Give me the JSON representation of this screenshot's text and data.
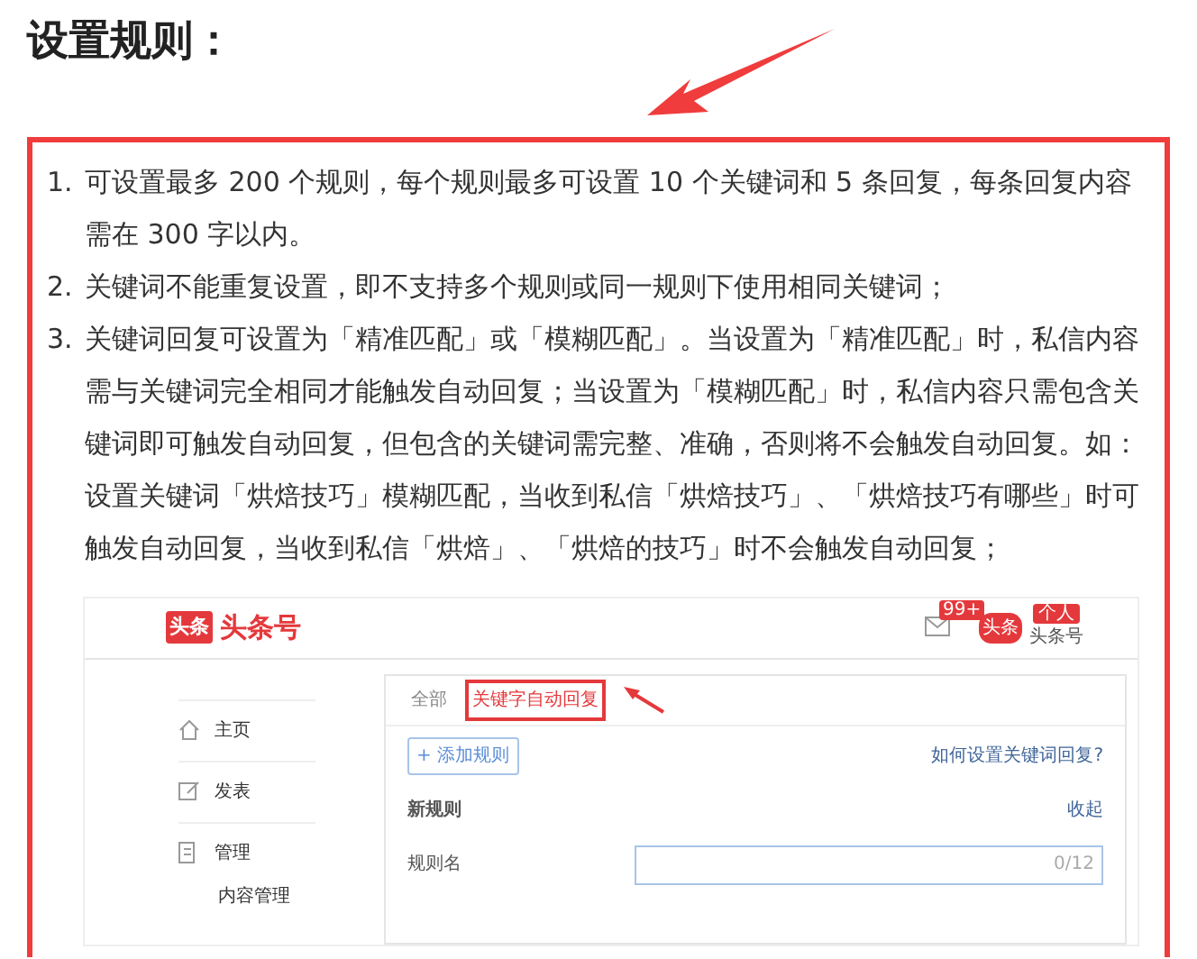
{
  "heading": "设置规则：",
  "rules": [
    {
      "number": "1.",
      "text": "可设置最多 200 个规则，每个规则最多可设置 10 个关键词和 5 条回复，每条回复内容需在 300 字以内。"
    },
    {
      "number": "2.",
      "text": "关键词不能重复设置，即不支持多个规则或同一规则下使用相同关键词；"
    },
    {
      "number": "3.",
      "text": "关键词回复可设置为「精准匹配」或「模糊匹配」。当设置为「精准匹配」时，私信内容需与关键词完全相同才能触发自动回复；当设置为「模糊匹配」时，私信内容只需包含关键词即可触发自动回复，但包含的关键词需完整、准确，否则将不会触发自动回复。如：设置关键词「烘焙技巧」模糊匹配，当收到私信「烘焙技巧」、「烘焙技巧有哪些」时可触发自动回复，当收到私信「烘焙」、「烘焙的技巧」时不会触发自动回复；"
    }
  ],
  "screenshot": {
    "logo_badge": "头条",
    "logo_text": "头条号",
    "message_badge": "99+",
    "avatar_badge": "头条",
    "account_tag": "个人",
    "account_name": "头条号",
    "sidebar": [
      {
        "label": "主页"
      },
      {
        "label": "发表"
      },
      {
        "label": "管理",
        "children": [
          {
            "label": "内容管理"
          }
        ]
      }
    ],
    "tabs": [
      {
        "label": "全部",
        "selected": false
      },
      {
        "label": "关键字自动回复",
        "selected": true
      }
    ],
    "add_button": "+ 添加规则",
    "help_link": "如何设置关键词回复?",
    "section_title": "新规则",
    "collapse_link": "收起",
    "field_label": "规则名",
    "field_counter": "0/12"
  }
}
